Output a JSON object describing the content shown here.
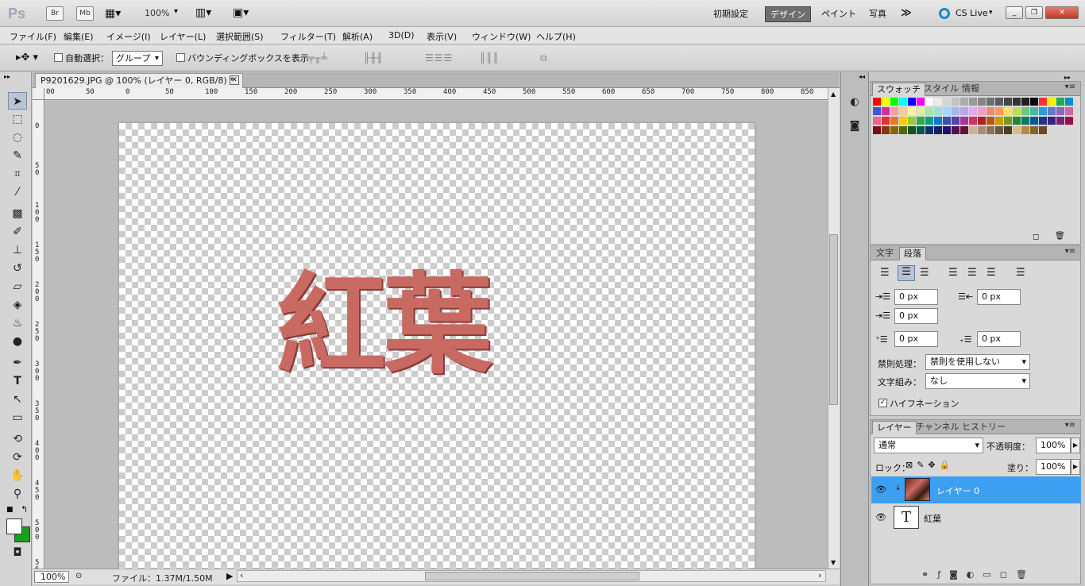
{
  "appbar": {
    "logo": "Ps",
    "bridge_label": "Br",
    "minibridge_label": "Mb",
    "zoom": "100%",
    "workspaces": [
      "初期設定",
      "デザイン",
      "ペイント",
      "写真"
    ],
    "more": "≫",
    "cslive": "CS Live"
  },
  "menus": [
    "ファイル(F)",
    "編集(E)",
    "イメージ(I)",
    "レイヤー(L)",
    "選択範囲(S)",
    "フィルター(T)",
    "解析(A)",
    "3D(D)",
    "表示(V)",
    "ウィンドウ(W)",
    "ヘルプ(H)"
  ],
  "options": {
    "auto_select_label": "自動選択：",
    "auto_select_value": "グループ",
    "bbox_label": "バウンディングボックスを表示"
  },
  "document": {
    "tab_title": "P9201629.JPG @ 100% (レイヤー 0, RGB/8) *",
    "canvas_text": "紅葉",
    "ruler_top": [
      "00",
      "50",
      "0",
      "50",
      "100",
      "150",
      "200",
      "250",
      "300",
      "350",
      "400",
      "450",
      "500",
      "550",
      "600",
      "650",
      "700",
      "750",
      "800",
      "850"
    ],
    "ruler_left": [
      "0",
      "5 0",
      "1 0 0",
      "1 5 0",
      "2 0 0",
      "2 5 0",
      "3 0 0",
      "3 5 0",
      "4 0 0",
      "4 5 0",
      "5 0 0",
      "5 5 0"
    ]
  },
  "status": {
    "zoom": "100%",
    "file_info": "ファイル：1.37M/1.50M"
  },
  "swatch_panel": {
    "tabs": [
      "スウォッチ",
      "スタイル",
      "情報"
    ],
    "colors": [
      "#ff0000",
      "#ffff00",
      "#00ff00",
      "#00ffff",
      "#0000ff",
      "#ff00ff",
      "#ffffff",
      "#ebebeb",
      "#d6d6d6",
      "#c2c2c2",
      "#adadad",
      "#999999",
      "#858585",
      "#707070",
      "#5c5c5c",
      "#474747",
      "#333333",
      "#1f1f1f",
      "#0a0a0a",
      "#ff3333",
      "#ffee00",
      "#22aa55",
      "#1188cc",
      "#4455cc",
      "#cc3399",
      "#f5a0a0",
      "#f6c7a0",
      "#fff2a0",
      "#d8f0a0",
      "#a8e6a8",
      "#9fe0d8",
      "#a0d8f5",
      "#a8b8ee",
      "#b8a8ee",
      "#e0a8ee",
      "#f0a0c8",
      "#ee8877",
      "#ff9955",
      "#ffdd66",
      "#bbdd55",
      "#66cc77",
      "#44bbaa",
      "#3399dd",
      "#6677cc",
      "#8866cc",
      "#cc66aa",
      "#ee6688",
      "#dd3333",
      "#ee7722",
      "#ffcc00",
      "#99cc33",
      "#33aa44",
      "#119988",
      "#1177cc",
      "#3355aa",
      "#5544aa",
      "#aa3399",
      "#cc3366",
      "#aa2222",
      "#bb5511",
      "#cc9900",
      "#779922",
      "#228833",
      "#117766",
      "#115599",
      "#223388",
      "#332288",
      "#772277",
      "#991144",
      "#771111",
      "#883311",
      "#886600",
      "#556611",
      "#115522",
      "#0d5544",
      "#0d3366",
      "#112266",
      "#221166",
      "#551155",
      "#660f33",
      "#c9b49a",
      "#a68f73",
      "#8a7258",
      "#6b5640",
      "#4d3b2a",
      "#d8b98a",
      "#b08850",
      "#8a6430",
      "#6b4a20"
    ]
  },
  "paragraph_panel": {
    "tabs": [
      "文字",
      "段落"
    ],
    "indent_left": "0 px",
    "indent_right": "0 px",
    "indent_first": "0 px",
    "space_before": "0 px",
    "space_after": "0 px",
    "kinsoku_label": "禁則処理：",
    "kinsoku_value": "禁則を使用しない",
    "mojikumi_label": "文字組み：",
    "mojikumi_value": "なし",
    "hyphenation_label": "ハイフネーション"
  },
  "layers_panel": {
    "tabs": [
      "レイヤー",
      "チャンネル",
      "ヒストリー"
    ],
    "blend_mode": "通常",
    "opacity_label": "不透明度：",
    "opacity": "100%",
    "lock_label": "ロック：",
    "fill_label": "塗り：",
    "fill": "100%",
    "layers": [
      {
        "name": "レイヤー 0",
        "selected": true
      },
      {
        "name": "紅葉",
        "selected": false
      }
    ],
    "type_thumb": "T"
  },
  "colors": {
    "accent_selected_layer": "#3d9ff2",
    "foreground": "#ffffff",
    "background": "#1aa01a"
  }
}
